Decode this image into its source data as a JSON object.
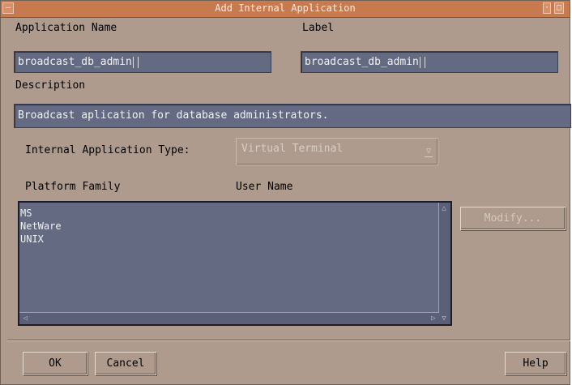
{
  "window": {
    "title": "Add Internal Application"
  },
  "form": {
    "app_name_label": "Application Name",
    "app_name_value": "broadcast_db_admin",
    "label_label": "Label",
    "label_value": "broadcast_db_admin",
    "description_label": "Description",
    "description_value": "Broadcast aplication for database administrators.",
    "type_label": "Internal Application Type:",
    "type_value": "Virtual Terminal",
    "platform_header": "Platform Family",
    "user_header": "User Name"
  },
  "platforms": [
    {
      "name": "MS"
    },
    {
      "name": "NetWare"
    },
    {
      "name": "UNIX"
    }
  ],
  "buttons": {
    "modify": "Modify...",
    "ok": "OK",
    "cancel": "Cancel",
    "help": "Help"
  },
  "colors": {
    "window_bg": "#ae9b8e",
    "titlebar": "#c87a4f",
    "field_bg": "#646a82"
  },
  "icons": {
    "window_menu": "window-menu-icon",
    "minimize": "minimize-icon",
    "maximize": "maximize-icon",
    "dropdown": "dropdown-arrow-icon"
  }
}
